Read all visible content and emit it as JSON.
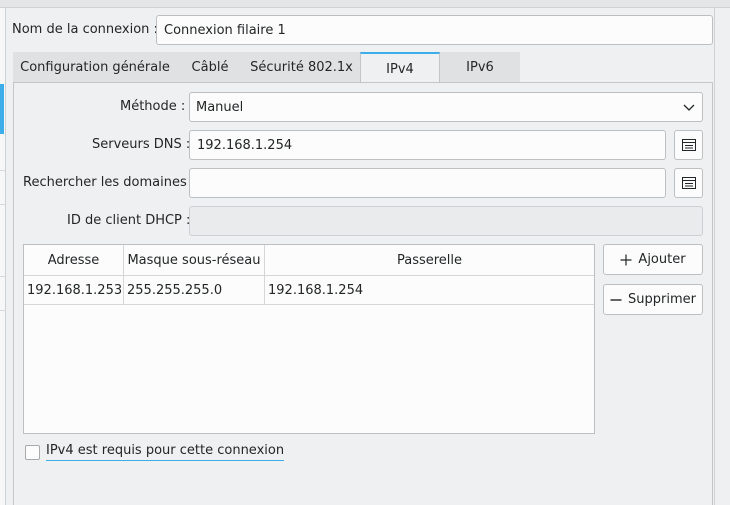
{
  "connection": {
    "name_label": "Nom de la connexion :",
    "name_value": "Connexion filaire 1"
  },
  "tabs": [
    {
      "label": "Configuration générale",
      "active": false
    },
    {
      "label": "Câblé",
      "active": false
    },
    {
      "label": "Sécurité 802.1x",
      "active": false
    },
    {
      "label": "IPv4",
      "active": true
    },
    {
      "label": "IPv6",
      "active": false
    }
  ],
  "ipv4": {
    "method_label": "Méthode :",
    "method_value": "Manuel",
    "dns_label": "Serveurs DNS :",
    "dns_value": "192.168.1.254",
    "search_label": "Rechercher les domaines :",
    "search_value": "",
    "dhcp_label": "ID de client DHCP :",
    "dhcp_value": "",
    "table": {
      "columns": [
        "Adresse",
        "Masque sous-réseau",
        "Passerelle"
      ],
      "rows": [
        [
          "192.168.1.253",
          "255.255.255.0",
          "192.168.1.254"
        ]
      ]
    },
    "add_label": "Ajouter",
    "remove_label": "Supprimer",
    "required_label": "IPv4 est requis pour cette connexion",
    "required_checked": false
  },
  "colors": {
    "accent": "#3daee9",
    "window_bg": "#eff0f1",
    "field_bg": "#fcfcfc"
  },
  "icons": [
    "chevron-down-icon",
    "edit-list-icon",
    "plus-icon",
    "minus-icon"
  ]
}
